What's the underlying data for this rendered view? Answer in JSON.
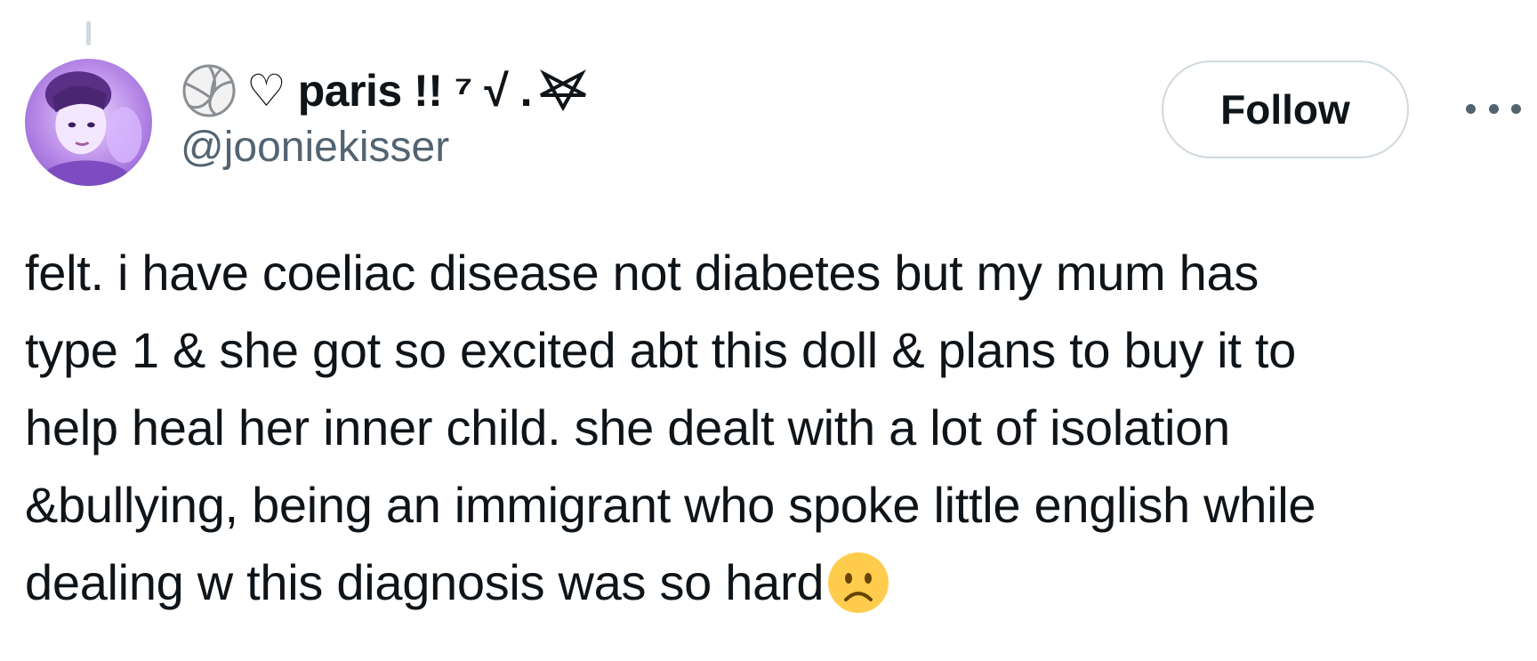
{
  "tweet": {
    "author": {
      "display_name": "♡ paris !! ⁷ √ .",
      "handle": "@jooniekisser",
      "name_icons": [
        "volleyball-icon",
        "pentagram-icon"
      ]
    },
    "follow_label": "Follow",
    "text_lines": [
      "felt. i have coeliac disease not diabetes but my mum has",
      "type 1 & she got so excited abt this doll & plans to buy it to",
      "help heal her inner child. she dealt with a lot of isolation",
      "&bullying, being an immigrant who spoke little english while",
      "dealing w this diagnosis was so hard"
    ],
    "trailing_emoji": "slightly-frowning-face-icon"
  },
  "colors": {
    "text_primary": "#0f1419",
    "text_secondary": "#536471",
    "border": "#cfd9de",
    "avatar_tint": "#c9a6f2"
  }
}
